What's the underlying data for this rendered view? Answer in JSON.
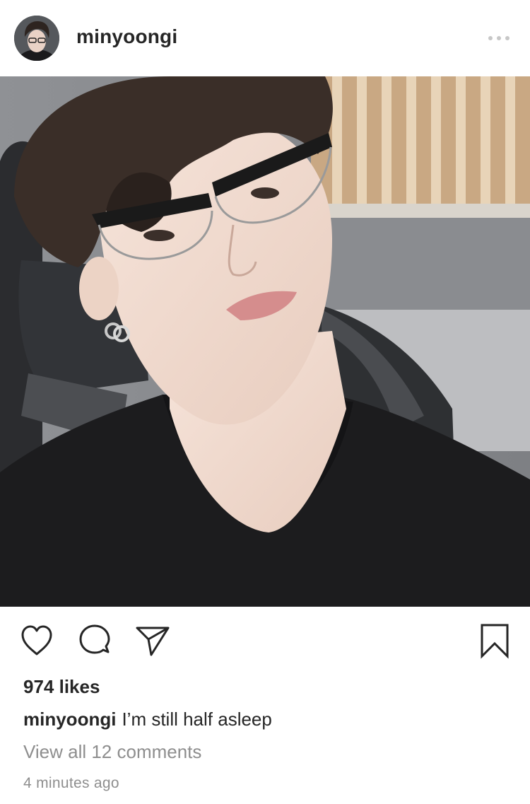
{
  "post": {
    "username": "minyoongi",
    "likes": "974 likes",
    "caption_user": "minyoongi",
    "caption_text": "I’m still half asleep",
    "view_comments": "View all 12 comments",
    "timestamp": "4 minutes ago"
  },
  "icons": {
    "more": "more-options-icon",
    "like": "heart-icon",
    "comment": "comment-icon",
    "share": "send-icon",
    "save": "bookmark-icon"
  },
  "colors": {
    "text": "#262626",
    "muted": "#8e8e8e",
    "background": "#ffffff"
  }
}
